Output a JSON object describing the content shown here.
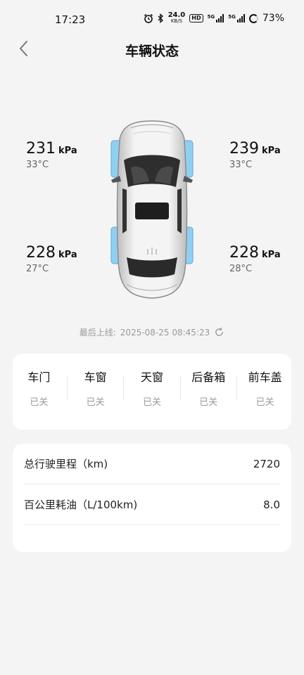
{
  "status_bar": {
    "time": "17:23",
    "net_speed": "24.0",
    "net_unit": "KB/S",
    "hd_label": "HD",
    "sim1": "5G",
    "sim2": "5G",
    "battery": "73%"
  },
  "header": {
    "title": "车辆状态",
    "back_icon": "chevron-left-icon"
  },
  "tyres": {
    "front_left": {
      "pressure": "231",
      "unit": "kPa",
      "temp": "33°C"
    },
    "front_right": {
      "pressure": "239",
      "unit": "kPa",
      "temp": "33°C"
    },
    "rear_left": {
      "pressure": "228",
      "unit": "kPa",
      "temp": "27°C"
    },
    "rear_right": {
      "pressure": "228",
      "unit": "kPa",
      "temp": "28°C"
    }
  },
  "last_online": {
    "label": "最后上线:",
    "time": "2025-08-25 08:45:23",
    "icon": "refresh-icon"
  },
  "status": {
    "items": [
      {
        "label": "车门",
        "value": "已关"
      },
      {
        "label": "车窗",
        "value": "已关"
      },
      {
        "label": "天窗",
        "value": "已关"
      },
      {
        "label": "后备箱",
        "value": "已关"
      },
      {
        "label": "前车盖",
        "value": "已关"
      }
    ]
  },
  "info": {
    "rows": [
      {
        "label": "总行驶里程（km)",
        "value": "2720"
      },
      {
        "label": "百公里耗油（L/100km)",
        "value": "8.0"
      }
    ]
  },
  "colors": {
    "accent_tyre": "#8fd0f2",
    "bg": "#f4f4f4",
    "card": "#ffffff"
  }
}
